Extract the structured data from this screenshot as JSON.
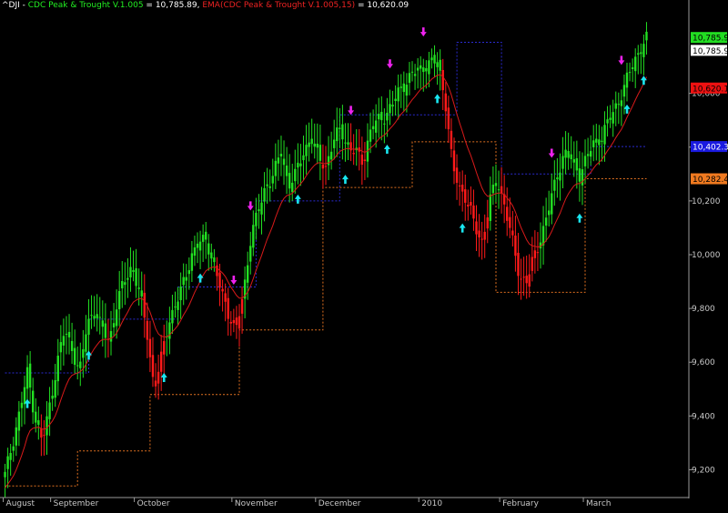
{
  "header": {
    "symbol": "^DJI",
    "sep1": " - ",
    "indicator": "CDC Peak & Trought V.1.005",
    "indicator_value": " = 10,785.89, ",
    "ema": "EMA(CDC Peak & Trought V.1.005,15)",
    "ema_value": " = 10,620.09"
  },
  "colors": {
    "background": "#000000",
    "up": "#22e022",
    "down": "#ff1a1a",
    "ema": "#d81a1a",
    "peak_line": "#2a2ad0",
    "trough_line": "#e07020",
    "arrow_up": "#19e6f0",
    "arrow_down": "#ee22ee",
    "grid_text": "#c8c8c8",
    "header_white": "#ffffff",
    "header_green": "#22ee22",
    "header_red": "#ee2222"
  },
  "chart_data": {
    "type": "candlestick",
    "ylim": [
      9100,
      10900
    ],
    "y_ticks": [
      "9,200",
      "9,400",
      "9,600",
      "9,800",
      "10,000",
      "10,200",
      "10,400",
      "10,600"
    ],
    "y_tick_values": [
      9200,
      9400,
      9600,
      9800,
      10000,
      10200,
      10400,
      10600
    ],
    "x_labels": [
      "August",
      "September",
      "October",
      "November",
      "December",
      "2010",
      "February",
      "March"
    ],
    "x_label_index": [
      0,
      17,
      47,
      82,
      112,
      149,
      178,
      208
    ],
    "close_path": [
      9180,
      9300,
      9420,
      9560,
      9400,
      9300,
      9440,
      9600,
      9720,
      9650,
      9560,
      9740,
      9800,
      9720,
      9680,
      9820,
      9900,
      9960,
      9860,
      9720,
      9500,
      9620,
      9760,
      9820,
      9900,
      10000,
      10040,
      10060,
      9960,
      9860,
      9780,
      9720,
      9860,
      10080,
      10160,
      10260,
      10300,
      10380,
      10260,
      10300,
      10380,
      10440,
      10360,
      10330,
      10420,
      10470,
      10400,
      10380,
      10350,
      10460,
      10500,
      10520,
      10560,
      10620,
      10650,
      10680,
      10700,
      10710,
      10720,
      10580,
      10320,
      10250,
      10200,
      10100,
      10050,
      10200,
      10280,
      10180,
      10050,
      9920,
      9900,
      10000,
      10080,
      10180,
      10300,
      10380,
      10350,
      10300,
      10360,
      10420,
      10440,
      10500,
      10560,
      10620,
      10700,
      10760,
      10800
    ],
    "ema15_last": 10620.09,
    "last_value": 10785.9,
    "series": [
      {
        "name": "CDC Peak & Trought V.1.005",
        "value": 10785.89
      },
      {
        "name": "EMA(CDC Peak & Trought V.1.005,15)",
        "value": 10620.09
      }
    ],
    "peak_levels": [
      {
        "from": 0,
        "to": 30,
        "value": 9560
      },
      {
        "from": 30,
        "to": 62,
        "value": 9760
      },
      {
        "from": 62,
        "to": 90,
        "value": 9880
      },
      {
        "from": 90,
        "to": 120,
        "value": 10200
      },
      {
        "from": 120,
        "to": 162,
        "value": 10520
      },
      {
        "from": 162,
        "to": 178,
        "value": 10790
      },
      {
        "from": 178,
        "to": 210,
        "value": 10300
      },
      {
        "from": 210,
        "to": 230,
        "value": 10402.3
      }
    ],
    "trough_levels": [
      {
        "from": 0,
        "to": 26,
        "value": 9140
      },
      {
        "from": 26,
        "to": 52,
        "value": 9270
      },
      {
        "from": 52,
        "to": 84,
        "value": 9480
      },
      {
        "from": 84,
        "to": 114,
        "value": 9720
      },
      {
        "from": 114,
        "to": 146,
        "value": 10250
      },
      {
        "from": 146,
        "to": 176,
        "value": 10420
      },
      {
        "from": 176,
        "to": 208,
        "value": 9860
      },
      {
        "from": 208,
        "to": 230,
        "value": 10282.4
      }
    ],
    "up_arrows": [
      8,
      30,
      57,
      70,
      105,
      122,
      137,
      155,
      164,
      206,
      223,
      229
    ],
    "down_arrows": [
      82,
      88,
      124,
      138,
      150,
      196,
      221
    ],
    "price_labels": [
      {
        "text": "10,785.9",
        "value": 10808,
        "color": "green"
      },
      {
        "text": "10,785.9",
        "value": 10760,
        "color": "white"
      },
      {
        "text": "10,620.1",
        "value": 10620,
        "color": "red"
      },
      {
        "text": "10,402.3",
        "value": 10402.3,
        "color": "blue"
      },
      {
        "text": "10,282.4",
        "value": 10282.4,
        "color": "orange"
      }
    ]
  }
}
